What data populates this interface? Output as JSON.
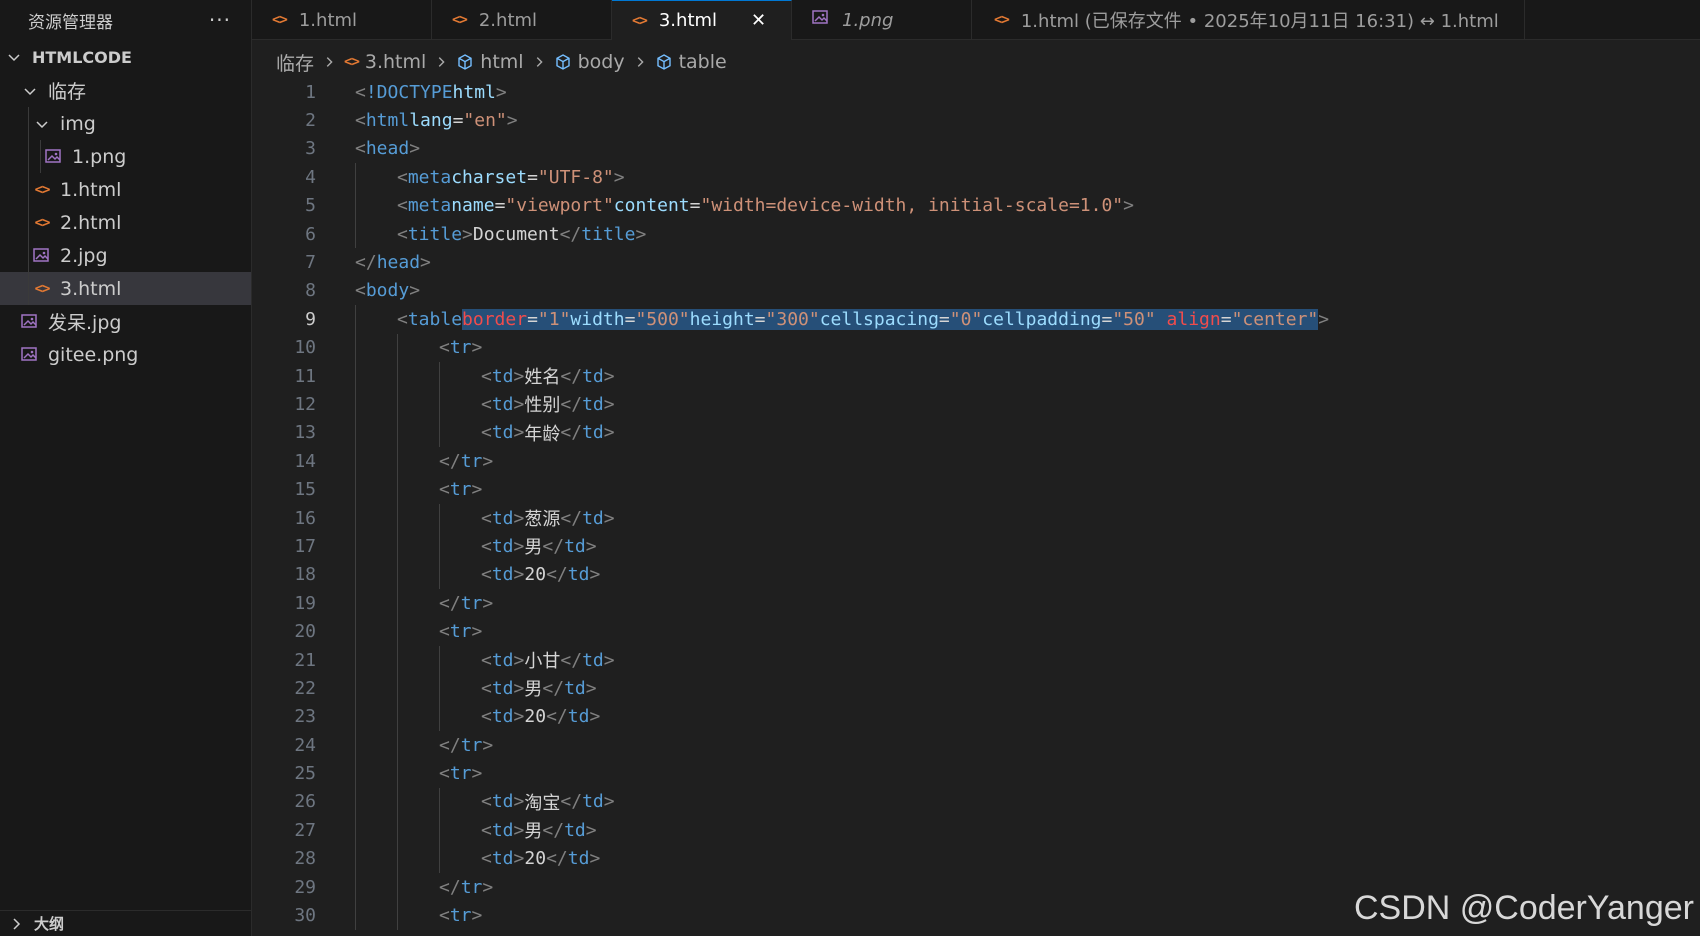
{
  "sidebar": {
    "title": "资源管理器",
    "more": "···",
    "root": "HTMLCODE",
    "items": [
      {
        "label": "临存",
        "type": "folder"
      },
      {
        "label": "img",
        "type": "folder"
      },
      {
        "label": "1.png",
        "type": "image"
      },
      {
        "label": "1.html",
        "type": "html"
      },
      {
        "label": "2.html",
        "type": "html"
      },
      {
        "label": "2.jpg",
        "type": "image"
      },
      {
        "label": "3.html",
        "type": "html"
      },
      {
        "label": "发呆.jpg",
        "type": "image"
      },
      {
        "label": "gitee.png",
        "type": "image"
      }
    ],
    "outline": "大纲"
  },
  "tabs": [
    {
      "label": "1.html",
      "type": "html"
    },
    {
      "label": "2.html",
      "type": "html"
    },
    {
      "label": "3.html",
      "type": "html",
      "active": true
    },
    {
      "label": "1.png",
      "type": "image",
      "preview": true
    },
    {
      "label": "1.html (已保存文件 • 2025年10月11日 16:31) ↔ 1.html",
      "type": "html"
    }
  ],
  "breadcrumb": [
    "临存",
    "3.html",
    "html",
    "body",
    "table"
  ],
  "editor": {
    "line_numbers": [
      "1",
      "2",
      "3",
      "4",
      "5",
      "6",
      "7",
      "8",
      "9",
      "10",
      "11",
      "12",
      "13",
      "14",
      "15",
      "16",
      "17",
      "18",
      "19",
      "20",
      "21",
      "22",
      "23",
      "24",
      "25",
      "26",
      "27",
      "28",
      "29",
      "30"
    ],
    "current_line": 9,
    "code": {
      "l1": "<!DOCTYPE html>",
      "l2_tag": "html",
      "l2_attr": "lang",
      "l2_val": "\"en\"",
      "l3": "head",
      "l4_tag": "meta",
      "l4_attr": "charset",
      "l4_val": "\"UTF-8\"",
      "l5_tag": "meta",
      "l5_attr1": "name",
      "l5_val1": "\"viewport\"",
      "l5_attr2": "content",
      "l5_val2": "\"width=device-width, initial-scale=1.0\"",
      "l6_tag": "title",
      "l6_text": "Document",
      "l7": "head",
      "l8": "body",
      "l9_tag": "table",
      "l9_attrs": [
        {
          "name": "border",
          "value": "\"1\"",
          "error": true
        },
        {
          "name": "width",
          "value": "\"500\""
        },
        {
          "name": "height",
          "value": "\"300\""
        },
        {
          "name": "cellspacing",
          "value": "\"0\""
        },
        {
          "name": "cellpadding",
          "value": "\"50\""
        },
        {
          "name": "align",
          "value": "\"center\"",
          "error": true
        }
      ],
      "tr": "tr",
      "td": "td",
      "cells": [
        "姓名",
        "性别",
        "年龄",
        "葱源",
        "男",
        "20",
        "小甘",
        "男",
        "20",
        "淘宝",
        "男",
        "20"
      ]
    }
  },
  "watermark": "CSDN @CoderYanger",
  "colors": {
    "accent": "#0078d4",
    "tag": "#569cd6",
    "attr": "#9cdcfe",
    "value": "#ce9178",
    "error": "#f14c4c",
    "selection": "#264f78"
  }
}
